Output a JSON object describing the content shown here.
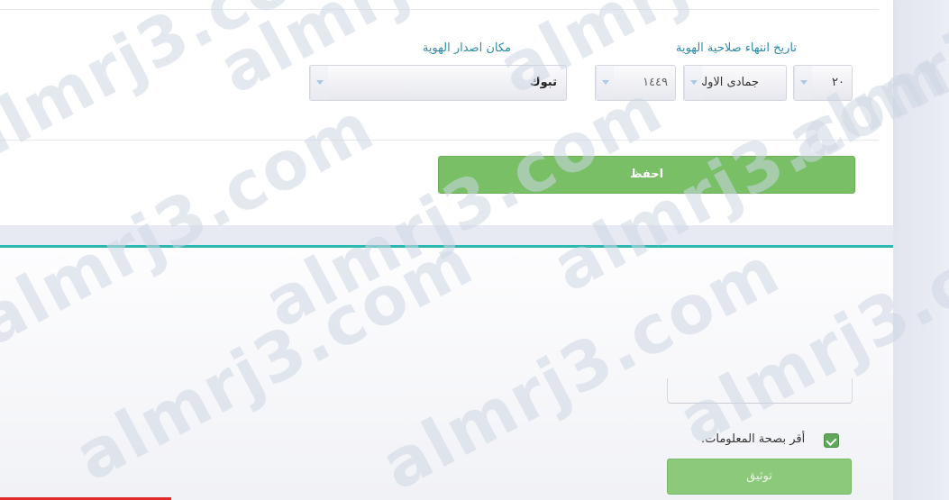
{
  "form": {
    "expiry_label": "تاريخ انتهاء صلاحية الهوية",
    "expiry_day": "٢٠",
    "expiry_month": "جمادى الاولى",
    "expiry_year": "١٤٤٩",
    "issue_place_label": "مكان اصدار الهوية",
    "issue_place": "تبوك",
    "save_label": "احفظ"
  },
  "confirm": {
    "agree_label": "أقر بصحة المعلومات.",
    "agree_checked": true,
    "confirm_label": "توثيق"
  },
  "watermark": {
    "text": "almrj3.com"
  },
  "colors": {
    "accent_label": "#2e8aa6",
    "save_green": "#79bf66",
    "confirm_green": "#8cc97b",
    "teal_line": "#2eb9b0"
  }
}
